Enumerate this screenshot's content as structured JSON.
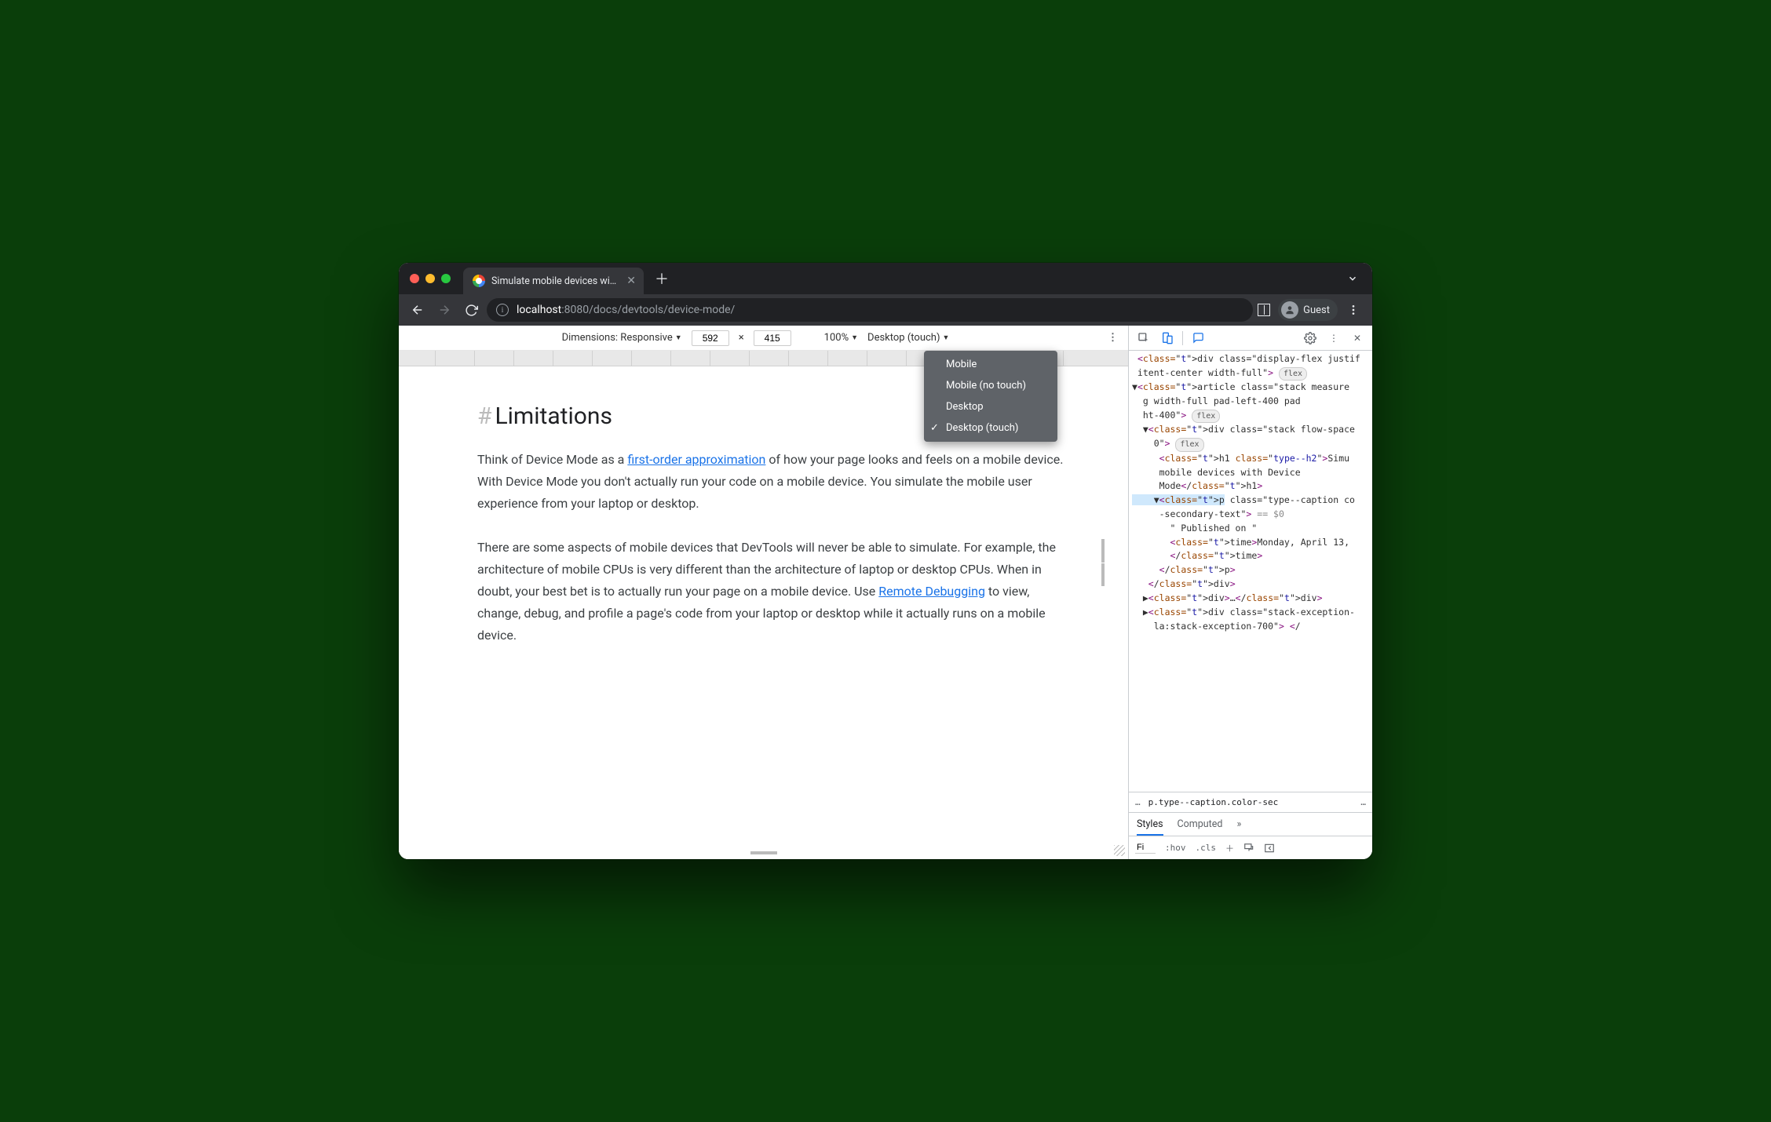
{
  "tab": {
    "title": "Simulate mobile devices with D"
  },
  "toolbar": {
    "guest_label": "Guest"
  },
  "url": {
    "host": "localhost",
    "port_path": ":8080/docs/devtools/device-mode/"
  },
  "device_toolbar": {
    "dimensions_label": "Dimensions: Responsive",
    "width": "592",
    "sep": "×",
    "height": "415",
    "zoom": "100%",
    "device_type": "Desktop (touch)"
  },
  "device_type_menu": {
    "items": [
      "Mobile",
      "Mobile (no touch)",
      "Desktop",
      "Desktop (touch)"
    ],
    "selected": 3
  },
  "page": {
    "heading": "Limitations",
    "p1_a": "Think of Device Mode as a ",
    "p1_link": "first-order approximation",
    "p1_b": " of how your page looks and feels on a mobile device. With Device Mode you don't actually run your code on a mobile device. You simulate the mobile user experience from your laptop or desktop.",
    "p2_a": "There are some aspects of mobile devices that DevTools will never be able to simulate. For example, the architecture of mobile CPUs is very different than the architecture of laptop or desktop CPUs. When in doubt, your best bet is to actually run your page on a mobile device. Use ",
    "p2_link": "Remote Debugging",
    "p2_b": " to view, change, debug, and profile a page's code from your laptop or desktop while it actually runs on a mobile device."
  },
  "devtools": {
    "crumb": "p.type--caption.color-sec",
    "styles_tabs": {
      "styles": "Styles",
      "computed": "Computed"
    },
    "actions": {
      "filter": "Fi",
      "hov": ":hov",
      "cls": ".cls"
    },
    "dom": {
      "l1": "<div class=\"display-flex justif",
      "l1b": "itent-center width-full\">",
      "flex": "flex",
      "l2a": "<article class=\"stack measure",
      "l2b": "g width-full pad-left-400 pad",
      "l2c": "ht-400\">",
      "l3a": "<div class=\"stack flow-space",
      "l3b": "0\">",
      "l4a": "<h1 class=\"type--h2\">Simu",
      "l4b": "mobile devices with Device",
      "l4c": "Mode</h1>",
      "l5a": "<p class=\"type--caption co",
      "l5b": "-secondary-text\">",
      "l5c": " == $0",
      "l6": "\" Published on \"",
      "l7a": "<time>Monday, April 13,",
      "l7b": "</time>",
      "l8": "</p>",
      "l9": "</div>",
      "l10": "<div>…</div>",
      "l11a": "<div class=\"stack-exception-",
      "l11b": "la:stack-exception-700\"> </"
    }
  }
}
